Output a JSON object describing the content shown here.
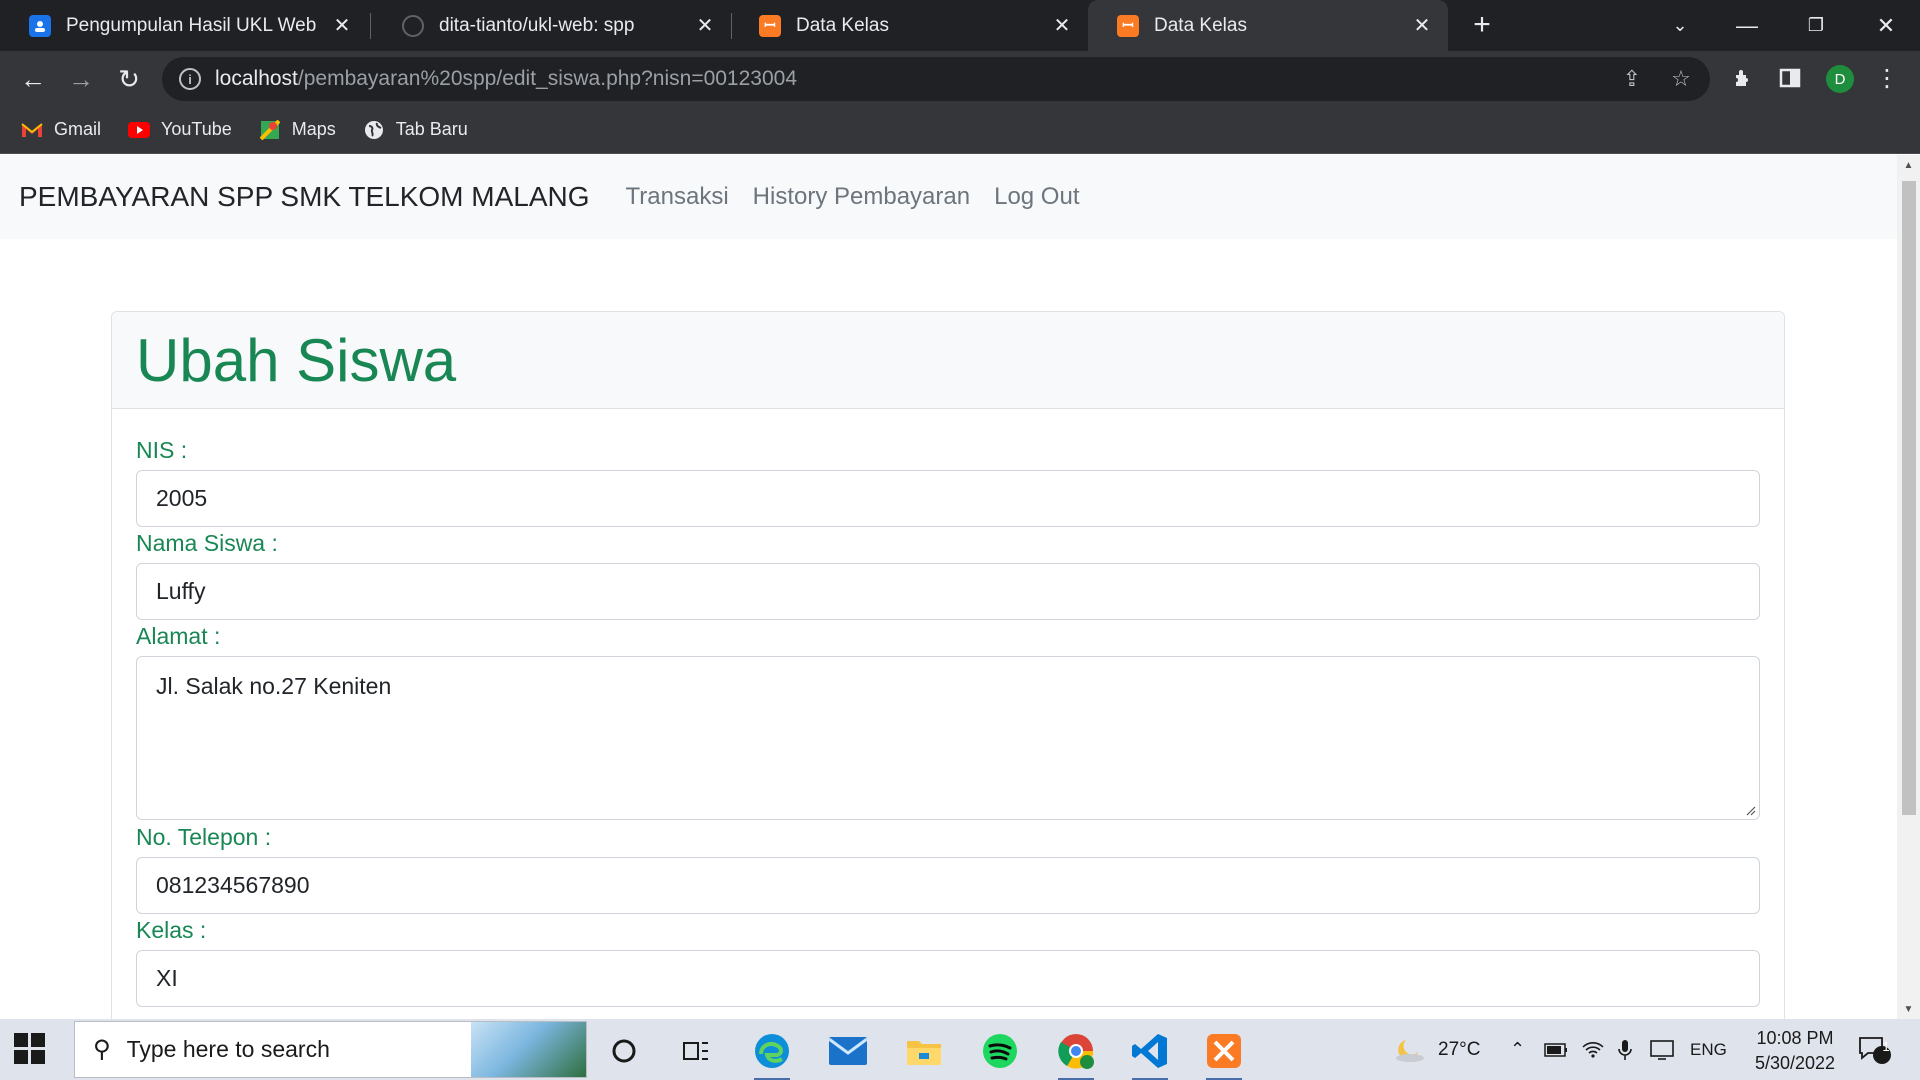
{
  "browser": {
    "tabs": [
      {
        "title": "Pengumpulan Hasil UKL Web",
        "favicon": "classroom-icon",
        "active": false
      },
      {
        "title": "dita-tianto/ukl-web: spp",
        "favicon": "github-icon",
        "active": false
      },
      {
        "title": "Data Kelas",
        "favicon": "xampp-icon",
        "active": false
      },
      {
        "title": "Data Kelas",
        "favicon": "xampp-icon",
        "active": true
      }
    ],
    "url_host": "localhost",
    "url_path": "/pembayaran%20spp/edit_siswa.php?nisn=00123004",
    "profile_initial": "D",
    "bookmarks": [
      {
        "label": "Gmail",
        "icon": "gmail-icon"
      },
      {
        "label": "YouTube",
        "icon": "youtube-icon"
      },
      {
        "label": "Maps",
        "icon": "maps-icon"
      },
      {
        "label": "Tab Baru",
        "icon": "globe-icon"
      }
    ]
  },
  "site": {
    "brand": "PEMBAYARAN SPP SMK TELKOM MALANG",
    "nav": [
      "Transaksi",
      "History Pembayaran",
      "Log Out"
    ]
  },
  "form": {
    "title": "Ubah Siswa",
    "fields": [
      {
        "label": "NIS :",
        "value": "2005"
      },
      {
        "label": "Nama Siswa :",
        "value": "Luffy"
      },
      {
        "label": "Alamat :",
        "value": "Jl. Salak no.27 Keniten"
      },
      {
        "label": "No. Telepon :",
        "value": "081234567890"
      },
      {
        "label": "Kelas :",
        "value": "XI"
      }
    ]
  },
  "taskbar": {
    "search_placeholder": "Type here to search",
    "temperature": "27°C",
    "language": "ENG",
    "time": "10:08 PM",
    "date": "5/30/2022",
    "notification_count": "1"
  },
  "colors": {
    "accent_green": "#198754",
    "chrome_dark": "#202124",
    "chrome_toolbar": "#35363a"
  }
}
